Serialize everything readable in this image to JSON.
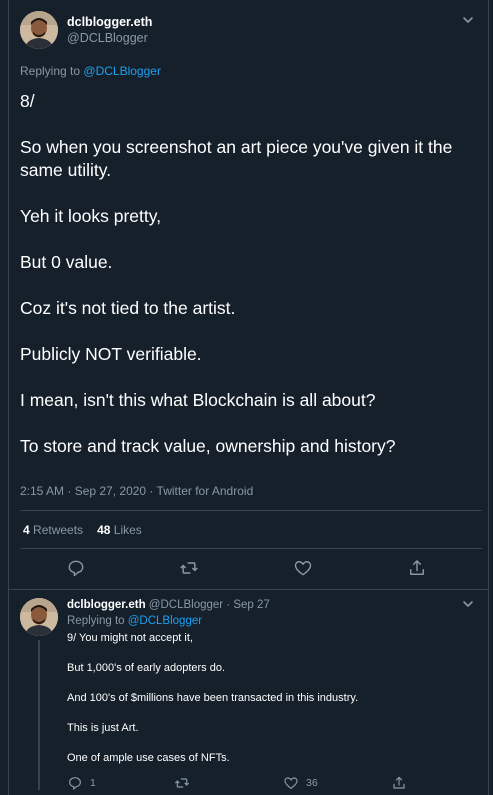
{
  "main_tweet": {
    "display_name": "dclblogger.eth",
    "handle": "@DCLBlogger",
    "replying_prefix": "Replying to",
    "replying_to": "@DCLBlogger",
    "paragraphs": [
      "8/",
      "So when you screenshot an art piece you've given it the same utility.",
      "Yeh it looks pretty,",
      "But 0 value.",
      "Coz it's not tied to the artist.",
      "Publicly NOT verifiable.",
      "I mean, isn't this what Blockchain is all about?",
      "To store and track value, ownership and history?"
    ],
    "timestamp": "2:15 AM · Sep 27, 2020 · Twitter for Android",
    "retweets_count": "4",
    "retweets_label": "Retweets",
    "likes_count": "48",
    "likes_label": "Likes",
    "action_icons": [
      "reply-icon",
      "retweet-icon",
      "like-icon",
      "share-icon"
    ]
  },
  "reply_tweet": {
    "display_name": "dclblogger.eth",
    "handle": "@DCLBlogger",
    "date": "· Sep 27",
    "replying_prefix": "Replying to",
    "replying_to": "@DCLBlogger",
    "paragraphs": [
      "9/ You might not accept it,",
      "But 1,000's of early adopters do.",
      "And 100's of $millions have been transacted in this industry.",
      "This is just Art.",
      "One of ample use cases of NFTs."
    ],
    "reply_count": "1",
    "retweet_count": "",
    "like_count": "36"
  },
  "colors": {
    "background": "#15202b",
    "secondary_text": "#8899a6",
    "link": "#1da1f2",
    "border": "#38444d"
  }
}
